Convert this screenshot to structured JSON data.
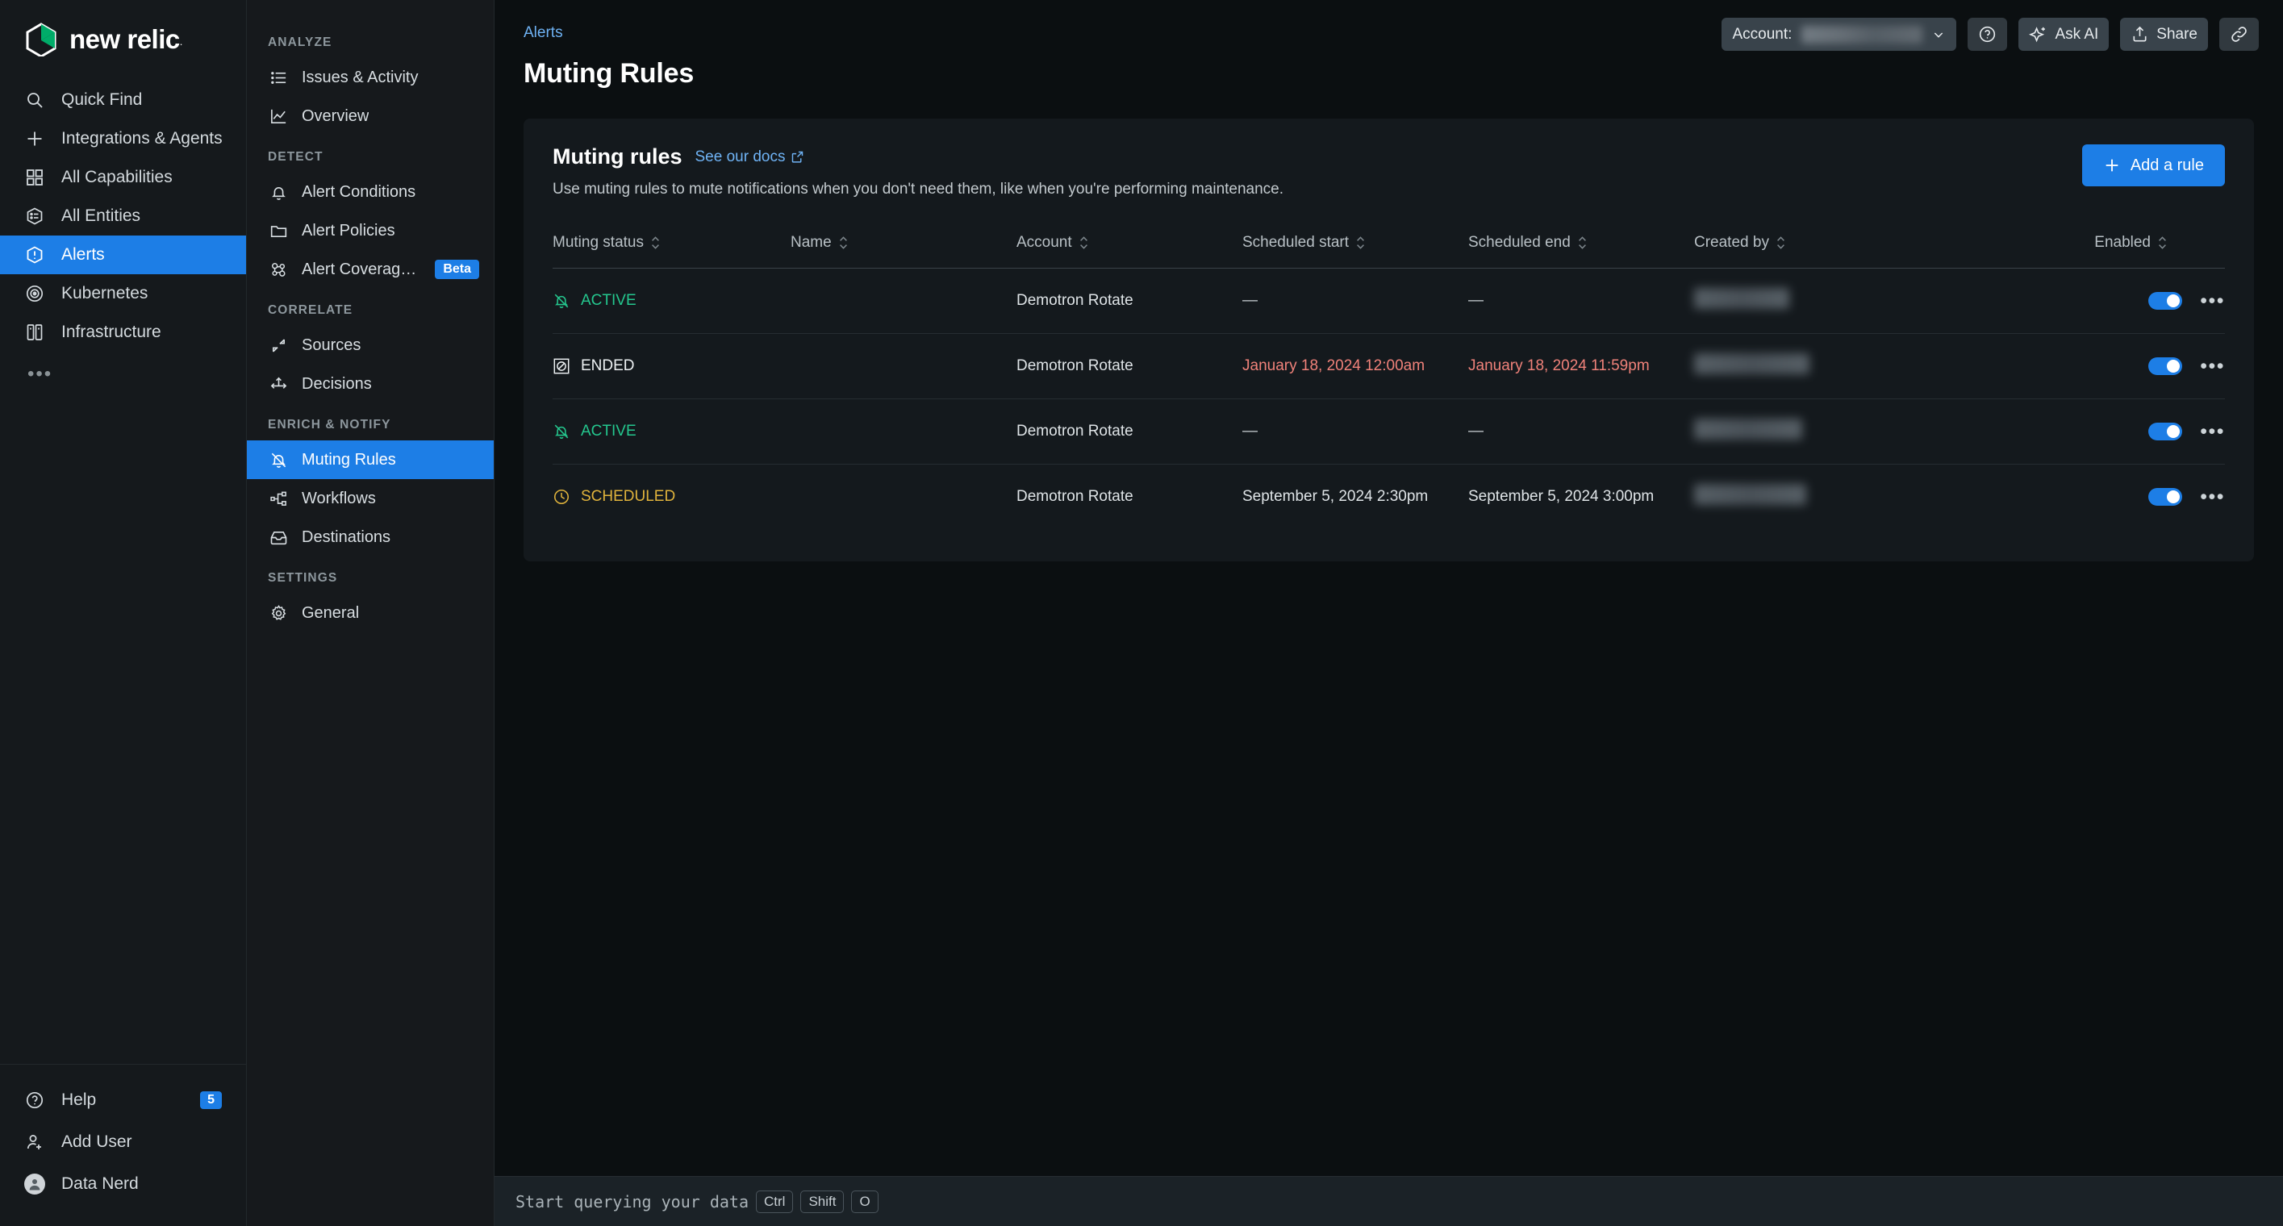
{
  "brand": {
    "name": "new relic",
    "trademark": "."
  },
  "primary_nav": {
    "items": [
      {
        "label": "Quick Find",
        "icon": "search-icon",
        "active": false
      },
      {
        "label": "Integrations & Agents",
        "icon": "plus-icon",
        "active": false
      },
      {
        "label": "All Capabilities",
        "icon": "grid-icon",
        "active": false
      },
      {
        "label": "All Entities",
        "icon": "entities-icon",
        "active": false
      },
      {
        "label": "Alerts",
        "icon": "alert-icon",
        "active": true
      },
      {
        "label": "Kubernetes",
        "icon": "kubernetes-icon",
        "active": false
      },
      {
        "label": "Infrastructure",
        "icon": "infrastructure-icon",
        "active": false
      }
    ],
    "more_label": "•••",
    "footer": [
      {
        "label": "Help",
        "icon": "help-icon",
        "badge": "5"
      },
      {
        "label": "Add User",
        "icon": "add-user-icon",
        "badge": ""
      },
      {
        "label": "Data Nerd",
        "icon": "avatar-icon",
        "badge": ""
      }
    ]
  },
  "secondary_nav": {
    "sections": [
      {
        "label": "ANALYZE",
        "items": [
          {
            "label": "Issues & Activity",
            "icon": "list-icon",
            "active": false,
            "badge": ""
          },
          {
            "label": "Overview",
            "icon": "chart-icon",
            "active": false,
            "badge": ""
          }
        ]
      },
      {
        "label": "DETECT",
        "items": [
          {
            "label": "Alert Conditions",
            "icon": "bell-icon",
            "active": false,
            "badge": ""
          },
          {
            "label": "Alert Policies",
            "icon": "folder-icon",
            "active": false,
            "badge": ""
          },
          {
            "label": "Alert Coverage G...",
            "icon": "coverage-icon",
            "active": false,
            "badge": "Beta"
          }
        ]
      },
      {
        "label": "CORRELATE",
        "items": [
          {
            "label": "Sources",
            "icon": "sources-icon",
            "active": false,
            "badge": ""
          },
          {
            "label": "Decisions",
            "icon": "decisions-icon",
            "active": false,
            "badge": ""
          }
        ]
      },
      {
        "label": "ENRICH & NOTIFY",
        "items": [
          {
            "label": "Muting Rules",
            "icon": "muted-bell-icon",
            "active": true,
            "badge": ""
          },
          {
            "label": "Workflows",
            "icon": "workflows-icon",
            "active": false,
            "badge": ""
          },
          {
            "label": "Destinations",
            "icon": "destinations-icon",
            "active": false,
            "badge": ""
          }
        ]
      },
      {
        "label": "SETTINGS",
        "items": [
          {
            "label": "General",
            "icon": "gear-icon",
            "active": false,
            "badge": ""
          }
        ]
      }
    ]
  },
  "header": {
    "breadcrumb": "Alerts",
    "page_title": "Muting Rules",
    "account_label": "Account:",
    "account_value_redacted": true,
    "help_icon": "question-circle-icon",
    "ask_ai_label": "Ask AI",
    "share_label": "Share",
    "link_icon": "link-icon"
  },
  "card": {
    "title": "Muting rules",
    "docs_link": "See our docs",
    "description": "Use muting rules to mute notifications when you don't need them, like when you're performing maintenance.",
    "add_button": "Add a rule"
  },
  "table": {
    "columns": [
      {
        "label": "Muting status",
        "sortable": true
      },
      {
        "label": "Name",
        "sortable": true
      },
      {
        "label": "Account",
        "sortable": true
      },
      {
        "label": "Scheduled start",
        "sortable": true
      },
      {
        "label": "Scheduled end",
        "sortable": true
      },
      {
        "label": "Created by",
        "sortable": true
      },
      {
        "label": "Enabled",
        "sortable": true
      }
    ],
    "rows": [
      {
        "status": "ACTIVE",
        "status_kind": "active",
        "name_redacted": true,
        "name_width": 46,
        "account": "Demotron Rotate",
        "scheduled_start": "—",
        "scheduled_start_kind": "dash",
        "scheduled_end": "—",
        "scheduled_end_kind": "dash",
        "created_by_redacted": true,
        "created_by_width": 118,
        "enabled": true,
        "menu": "•••"
      },
      {
        "status": "ENDED",
        "status_kind": "ended",
        "name_redacted": true,
        "name_width": 62,
        "account": "Demotron Rotate",
        "scheduled_start": "January 18, 2024  12:00am",
        "scheduled_start_kind": "red",
        "scheduled_end": "January 18, 2024  11:59pm",
        "scheduled_end_kind": "red",
        "created_by_redacted": true,
        "created_by_width": 143,
        "enabled": true,
        "menu": "•••"
      },
      {
        "status": "ACTIVE",
        "status_kind": "active",
        "name_redacted": true,
        "name_width": 52,
        "account": "Demotron Rotate",
        "scheduled_start": "—",
        "scheduled_start_kind": "dash",
        "scheduled_end": "—",
        "scheduled_end_kind": "dash",
        "created_by_redacted": true,
        "created_by_width": 134,
        "enabled": true,
        "menu": "•••"
      },
      {
        "status": "SCHEDULED",
        "status_kind": "scheduled",
        "name_redacted": true,
        "name_width": 40,
        "account": "Demotron Rotate",
        "scheduled_start": "September 5, 2024  2:30pm",
        "scheduled_start_kind": "normal",
        "scheduled_end": "September 5, 2024  3:00pm",
        "scheduled_end_kind": "normal",
        "created_by_redacted": true,
        "created_by_width": 139,
        "enabled": true,
        "menu": "•••"
      }
    ]
  },
  "bottom_bar": {
    "query_text": "Start querying your data",
    "keys": [
      "Ctrl",
      "Shift",
      "O"
    ],
    "info_icon": "info-icon"
  },
  "colors": {
    "accent_blue": "#1d7ee6",
    "link_blue": "#6fb3f5",
    "status_active": "#24c78e",
    "status_scheduled": "#e0b33c",
    "status_ended": "#eef2f4",
    "date_red": "#f0827a",
    "brand_green": "#00ac69"
  }
}
